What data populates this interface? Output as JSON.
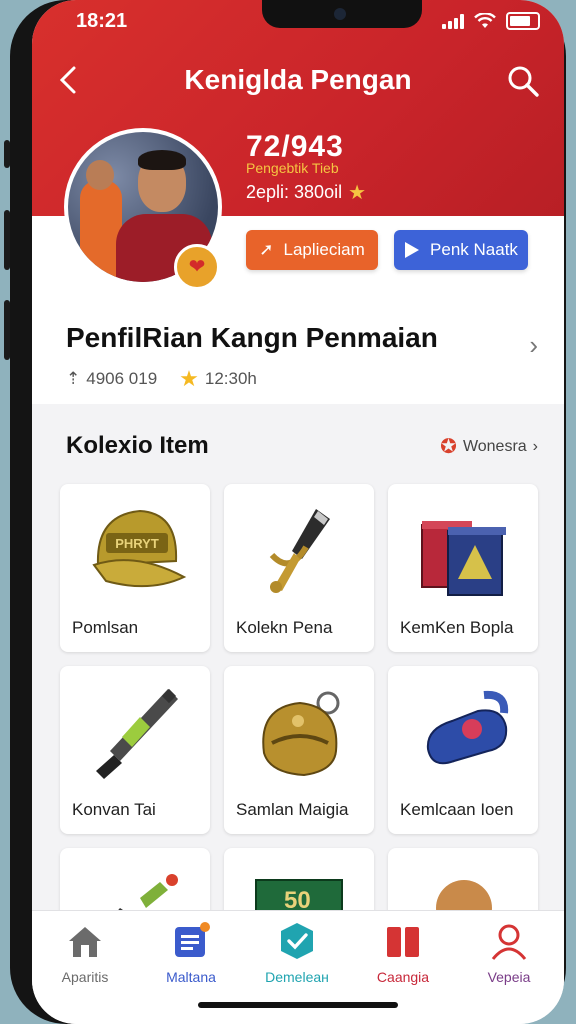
{
  "status": {
    "time": "18:21"
  },
  "header": {
    "title": "Keniglda Pengan"
  },
  "stats": {
    "number": "72/943",
    "sub": "Pengebtik Tieb",
    "line": "2epli: 380oil"
  },
  "buttons": {
    "orange": "Laplieciam",
    "blue": "Penk Naatk"
  },
  "profile": {
    "title": "PenfilRian Kangn Penmaian",
    "meta_views": "4906 019",
    "meta_time": "12:30h"
  },
  "section": {
    "title": "Kolexio Item",
    "link": "Wonesra"
  },
  "items": [
    {
      "label": "Pomlsan",
      "cap_text": "PHRYT"
    },
    {
      "label": "Kolekn Pena"
    },
    {
      "label": "KemKen Bopla"
    },
    {
      "label": "Konvan Tai"
    },
    {
      "label": "Samlan Maigia"
    },
    {
      "label": "Kemlcaan Ioen"
    },
    {
      "label": ""
    },
    {
      "label": "",
      "sign_text": "50"
    },
    {
      "label": ""
    }
  ],
  "nav": [
    {
      "label": "Aparitis",
      "color": "#6b6b6b"
    },
    {
      "label": "Maltana",
      "color": "#3b5bcc"
    },
    {
      "label": "Demeleaн",
      "color": "#20a4b0"
    },
    {
      "label": "Caangia",
      "color": "#c8283a"
    },
    {
      "label": "Vepeia",
      "color": "#7a3d88"
    }
  ],
  "colors": {
    "header_red": "#d32f2f",
    "accent_orange": "#e8632a",
    "accent_blue": "#3d63d8",
    "star_yellow": "#f5b922"
  }
}
